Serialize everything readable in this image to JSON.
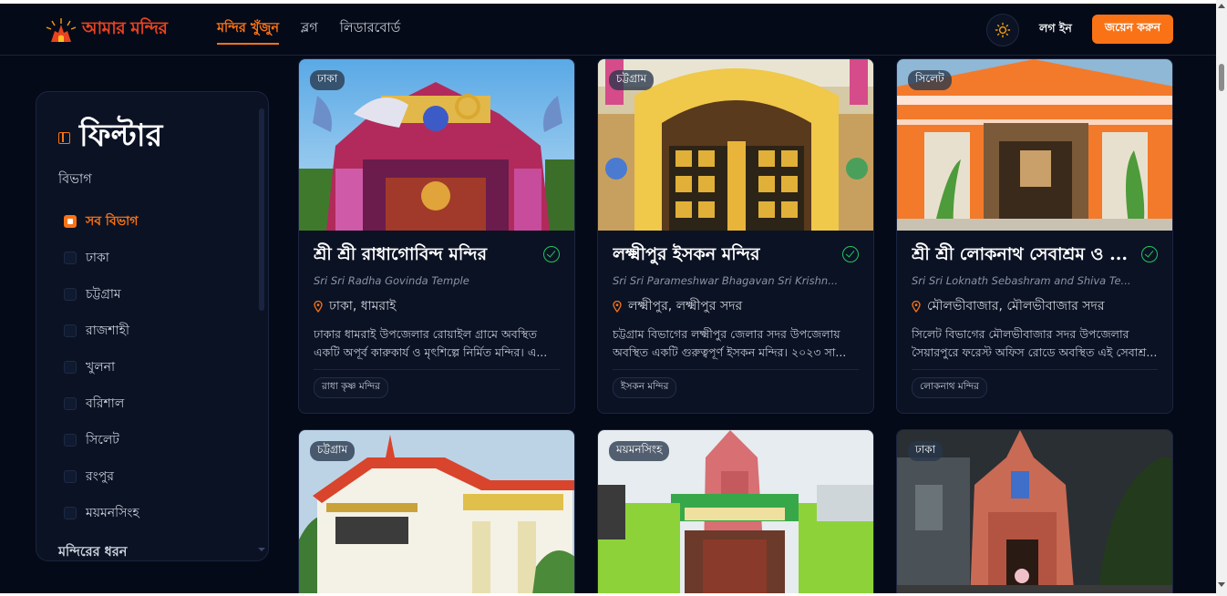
{
  "header": {
    "logo_text": "আমার মন্দির",
    "nav": [
      {
        "label": "মন্দির খুঁজুন",
        "active": true
      },
      {
        "label": "ব্লগ",
        "active": false
      },
      {
        "label": "লিডারবোর্ড",
        "active": false
      }
    ],
    "theme_icon": "sun-icon",
    "login_label": "লগ ইন",
    "join_label": "জয়েন করুন"
  },
  "sidebar": {
    "title": "ফিল্টার",
    "division_heading": "বিভাগ",
    "divisions": [
      {
        "label": "সব বিভাগ",
        "checked": true
      },
      {
        "label": "ঢাকা",
        "checked": false
      },
      {
        "label": "চট্টগ্রাম",
        "checked": false
      },
      {
        "label": "রাজশাহী",
        "checked": false
      },
      {
        "label": "খুলনা",
        "checked": false
      },
      {
        "label": "বরিশাল",
        "checked": false
      },
      {
        "label": "সিলেট",
        "checked": false
      },
      {
        "label": "রংপুর",
        "checked": false
      },
      {
        "label": "ময়মনসিংহ",
        "checked": false
      }
    ],
    "type_heading": "মন্দিরের ধরন"
  },
  "cards": [
    {
      "badge": "ঢাকা",
      "title": "শ্রী শ্রী রাধাগোবিন্দ মন্দির",
      "subtitle": "Sri Sri Radha Govinda Temple",
      "location": "ঢাকা, ধামরাই",
      "description": "ঢাকার ধামরাই উপজেলার রোয়াইল গ্রামে অবস্থিত একটি অপূর্ব কারুকার্য ও মৃৎশিল্পে নির্মিত মন্দির। এ...",
      "tag": "রাধা কৃষ্ণ মন্দির"
    },
    {
      "badge": "চট্টগ্রাম",
      "title": "লক্ষ্মীপুর ইসকন মন্দির",
      "subtitle": "Sri Sri Parameshwar Bhagavan Sri Krishn...",
      "location": "লক্ষ্মীপুর, লক্ষ্মীপুর সদর",
      "description": "চট্টগ্রাম বিভাগের লক্ষ্মীপুর জেলার সদর উপজেলায় অবস্থিত একটি গুরুত্বপূর্ণ ইসকন মন্দির। ২০২৩ সা...",
      "tag": "ইসকন মন্দির"
    },
    {
      "badge": "সিলেট",
      "title": "শ্রী শ্রী লোকনাথ সেবাশ্রম ও ...",
      "subtitle": "Sri Sri Loknath Sebashram and Shiva Te...",
      "location": "মৌলভীবাজার, মৌলভীবাজার সদর",
      "description": "সিলেট বিভাগের মৌলভীবাজার সদর উপজেলার সৈয়ারপুরে ফরেস্ট অফিস রোডে অবস্থিত এই সেবাশ্র...",
      "tag": "লোকনাথ মন্দির"
    },
    {
      "badge": "চট্টগ্রাম"
    },
    {
      "badge": "ময়মনসিংহ"
    },
    {
      "badge": "ঢাকা"
    }
  ],
  "colors": {
    "accent": "#f97316",
    "background": "#050a18",
    "card": "#0b1224",
    "verified": "#22c55e"
  }
}
